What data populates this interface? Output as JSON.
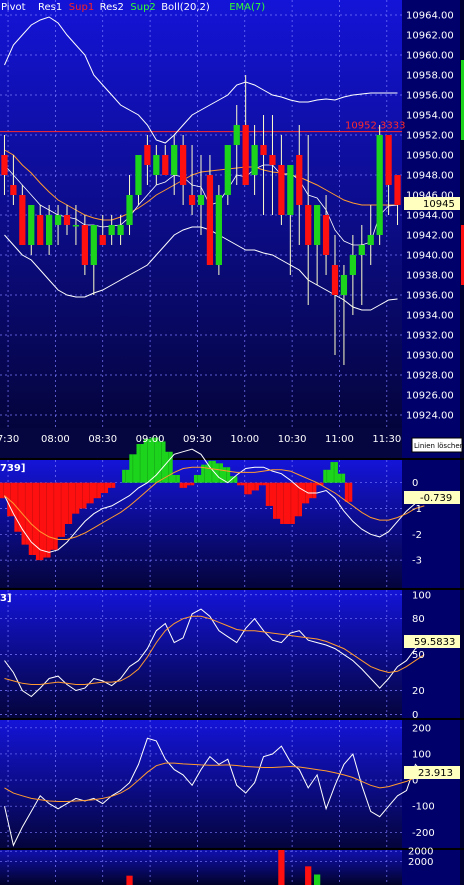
{
  "chart_data": [
    {
      "panel": "price",
      "type": "candlestick",
      "legend": [
        {
          "label": "Pivot",
          "color": "#ffffff"
        },
        {
          "label": "Res1",
          "color": "#ffffff"
        },
        {
          "label": "Sup1",
          "color": "#ff2020"
        },
        {
          "label": "Res2",
          "color": "#ffffff"
        },
        {
          "label": "Sup2",
          "color": "#30ff30"
        },
        {
          "label": "Boll(20,2)",
          "color": "#ffffff"
        },
        {
          "label": "EMA(7)",
          "color": "#30ff30"
        }
      ],
      "x_tick_labels": [
        "7:30",
        "08:00",
        "08:30",
        "09:00",
        "09:30",
        "10:00",
        "10:30",
        "11:00",
        "11:30"
      ],
      "y_tick_labels": [
        "10964.00",
        "10962.00",
        "10960.00",
        "10958.00",
        "10956.00",
        "10954.00",
        "10952.00",
        "10950.00",
        "10948.00",
        "10946.00",
        "10944.00",
        "10942.00",
        "10940.00",
        "10938.00",
        "10936.00",
        "10934.00",
        "10932.00",
        "10930.00",
        "10928.00",
        "10926.00",
        "10924.00"
      ],
      "ylim": [
        10922.7,
        10965.5
      ],
      "xlim": [
        0,
        45
      ],
      "ticks": [
        {
          "label": "10964.00",
          "value": 10964
        },
        {
          "label": "10962.00",
          "value": 10962
        },
        {
          "label": "10960.00",
          "value": 10960
        },
        {
          "label": "10958.00",
          "value": 10958
        },
        {
          "label": "10956.00",
          "value": 10956
        },
        {
          "label": "10954.00",
          "value": 10954
        },
        {
          "label": "10952.00",
          "value": 10952
        },
        {
          "label": "10950.00",
          "value": 10950
        },
        {
          "label": "10948.00",
          "value": 10948
        },
        {
          "label": "10946.00",
          "value": 10946
        },
        {
          "label": "10944.00",
          "value": 10944
        },
        {
          "label": "10942.00",
          "value": 10942
        },
        {
          "label": "10940.00",
          "value": 10940
        },
        {
          "label": "10938.00",
          "value": 10938
        },
        {
          "label": "10936.00",
          "value": 10936
        },
        {
          "label": "10934.00",
          "value": 10934
        },
        {
          "label": "10932.00",
          "value": 10932
        },
        {
          "label": "10930.00",
          "value": 10930
        },
        {
          "label": "10928.00",
          "value": 10928
        },
        {
          "label": "10926.00",
          "value": 10926
        },
        {
          "label": "10924.00",
          "value": 10924
        }
      ],
      "x_ticks": [
        {
          "label": "7:30",
          "index": 0.4
        },
        {
          "label": "08:00",
          "index": 5.7
        },
        {
          "label": "08:30",
          "index": 11.0
        },
        {
          "label": "09:00",
          "index": 16.3
        },
        {
          "label": "09:30",
          "index": 21.6
        },
        {
          "label": "10:00",
          "index": 26.9
        },
        {
          "label": "10:30",
          "index": 32.2
        },
        {
          "label": "11:00",
          "index": 37.5
        },
        {
          "label": "11:30",
          "index": 42.8
        }
      ],
      "candles": [
        {
          "o": 10950,
          "h": 10952,
          "l": 10946,
          "c": 10948
        },
        {
          "o": 10947,
          "h": 10950,
          "l": 10945,
          "c": 10946
        },
        {
          "o": 10946,
          "h": 10947,
          "l": 10941,
          "c": 10941
        },
        {
          "o": 10941,
          "h": 10945,
          "l": 10940,
          "c": 10945
        },
        {
          "o": 10944,
          "h": 10945,
          "l": 10941,
          "c": 10941
        },
        {
          "o": 10941,
          "h": 10945,
          "l": 10940,
          "c": 10944
        },
        {
          "o": 10943,
          "h": 10945,
          "l": 10941,
          "c": 10944
        },
        {
          "o": 10944,
          "h": 10945,
          "l": 10942,
          "c": 10943
        },
        {
          "o": 10943,
          "h": 10945,
          "l": 10941,
          "c": 10943
        },
        {
          "o": 10943,
          "h": 10944,
          "l": 10938,
          "c": 10939
        },
        {
          "o": 10939,
          "h": 10943,
          "l": 10936,
          "c": 10943
        },
        {
          "o": 10942,
          "h": 10944,
          "l": 10941,
          "c": 10941
        },
        {
          "o": 10942,
          "h": 10944,
          "l": 10941,
          "c": 10943
        },
        {
          "o": 10942,
          "h": 10944,
          "l": 10941,
          "c": 10943
        },
        {
          "o": 10943,
          "h": 10948,
          "l": 10942,
          "c": 10946
        },
        {
          "o": 10946,
          "h": 10950,
          "l": 10945,
          "c": 10950
        },
        {
          "o": 10951,
          "h": 10952,
          "l": 10947,
          "c": 10949
        },
        {
          "o": 10948,
          "h": 10951,
          "l": 10947,
          "c": 10950
        },
        {
          "o": 10950,
          "h": 10951,
          "l": 10948,
          "c": 10948
        },
        {
          "o": 10948,
          "h": 10952,
          "l": 10946,
          "c": 10951
        },
        {
          "o": 10951,
          "h": 10952,
          "l": 10945,
          "c": 10947
        },
        {
          "o": 10946,
          "h": 10951,
          "l": 10944,
          "c": 10945
        },
        {
          "o": 10945,
          "h": 10950,
          "l": 10942,
          "c": 10946
        },
        {
          "o": 10948,
          "h": 10950,
          "l": 10939,
          "c": 10939
        },
        {
          "o": 10939,
          "h": 10947,
          "l": 10938,
          "c": 10946
        },
        {
          "o": 10946,
          "h": 10951,
          "l": 10945,
          "c": 10951
        },
        {
          "o": 10951,
          "h": 10955,
          "l": 10947,
          "c": 10953
        },
        {
          "o": 10953,
          "h": 10958,
          "l": 10948,
          "c": 10947
        },
        {
          "o": 10948,
          "h": 10953,
          "l": 10946,
          "c": 10951
        },
        {
          "o": 10951,
          "h": 10954,
          "l": 10944,
          "c": 10950
        },
        {
          "o": 10950,
          "h": 10954,
          "l": 10944,
          "c": 10949
        },
        {
          "o": 10949,
          "h": 10952,
          "l": 10943,
          "c": 10944
        },
        {
          "o": 10944,
          "h": 10949,
          "l": 10938,
          "c": 10949
        },
        {
          "o": 10950,
          "h": 10953,
          "l": 10941,
          "c": 10945
        },
        {
          "o": 10945,
          "h": 10952,
          "l": 10935,
          "c": 10941
        },
        {
          "o": 10941,
          "h": 10945,
          "l": 10937,
          "c": 10945
        },
        {
          "o": 10944,
          "h": 10946,
          "l": 10938,
          "c": 10940
        },
        {
          "o": 10939,
          "h": 10942,
          "l": 10930,
          "c": 10936
        },
        {
          "o": 10936,
          "h": 10939,
          "l": 10929,
          "c": 10938
        },
        {
          "o": 10938,
          "h": 10942,
          "l": 10934,
          "c": 10940
        },
        {
          "o": 10940,
          "h": 10943,
          "l": 10935,
          "c": 10941
        },
        {
          "o": 10941,
          "h": 10945,
          "l": 10939,
          "c": 10942
        },
        {
          "o": 10942,
          "h": 10953,
          "l": 10941,
          "c": 10952
        },
        {
          "o": 10952,
          "h": 10952,
          "l": 10944,
          "c": 10947
        },
        {
          "o": 10948,
          "h": 10948,
          "l": 10943,
          "c": 10945
        }
      ],
      "boll_upper": [
        10959,
        10961,
        10962,
        10963,
        10963.5,
        10963.8,
        10963.2,
        10962,
        10961,
        10960,
        10958,
        10957,
        10956,
        10955,
        10954.5,
        10954,
        10953,
        10951.5,
        10951.2,
        10952,
        10953,
        10954,
        10954.5,
        10955,
        10955.5,
        10956,
        10957,
        10957.3,
        10957,
        10956.5,
        10956,
        10955.8,
        10955.5,
        10955.3,
        10955.3,
        10955.5,
        10955.6,
        10955.5,
        10955.8,
        10956,
        10956.1,
        10956.2,
        10956.2,
        10956.2,
        10956.2
      ],
      "boll_lower": [
        10942,
        10941,
        10940,
        10939.5,
        10938.5,
        10937.5,
        10936.5,
        10936,
        10935.8,
        10935.8,
        10936.2,
        10936.5,
        10937,
        10937.5,
        10938,
        10938.5,
        10939,
        10940,
        10941,
        10942,
        10942.5,
        10942.8,
        10942.8,
        10942.5,
        10942,
        10941.5,
        10941,
        10940.5,
        10940.5,
        10940.2,
        10940,
        10939.5,
        10939,
        10938.5,
        10937.5,
        10937,
        10936.5,
        10936,
        10935.5,
        10934.8,
        10934.5,
        10934.5,
        10935,
        10935.5,
        10935.6
      ],
      "boll_mid": [
        10950.5,
        10950,
        10949,
        10948.2,
        10947.2,
        10946.3,
        10945.5,
        10945,
        10944.5,
        10944,
        10943.7,
        10943.5,
        10943.5,
        10943.8,
        10944.2,
        10944.7,
        10945.3,
        10946,
        10946.5,
        10947,
        10947.5,
        10948,
        10948.3,
        10948.4,
        10948.5,
        10948.6,
        10948.7,
        10948.8,
        10948.8,
        10948.5,
        10948.3,
        10948.2,
        10948,
        10947.8,
        10947.4,
        10947,
        10946.5,
        10946,
        10945.5,
        10945.2,
        10945,
        10945,
        10945,
        10945,
        10945
      ],
      "ema": [
        10949,
        10948,
        10947,
        10946,
        10945,
        10944.5,
        10944,
        10943.8,
        10943.6,
        10943,
        10943,
        10942.8,
        10942.9,
        10943,
        10943.8,
        10945,
        10946,
        10947,
        10947.3,
        10948,
        10947.8,
        10947,
        10946.8,
        10945,
        10945.3,
        10946.6,
        10948,
        10947.8,
        10948.6,
        10949,
        10949,
        10948,
        10948.2,
        10947.5,
        10946,
        10945.7,
        10944.5,
        10942.5,
        10941.4,
        10941,
        10941,
        10941.3,
        10944,
        10944.9,
        10945
      ]
    },
    {
      "panel": "osc1",
      "type": "histogram+lines",
      "header_label": "739]",
      "ylim": [
        -4.08,
        0.88
      ],
      "ticks": [
        {
          "label": "0",
          "value": 0
        },
        {
          "label": "-1",
          "value": -1
        },
        {
          "label": "-2",
          "value": -2
        },
        {
          "label": "-3",
          "value": -3
        }
      ],
      "value_label": "-0.739",
      "histogram": [
        -0.6,
        -1.3,
        -1.9,
        -2.4,
        -2.8,
        -3.0,
        -2.9,
        -2.6,
        -2.1,
        -1.6,
        -1.2,
        -1.0,
        -0.8,
        -0.6,
        -0.4,
        -0.2,
        0.0,
        0.5,
        1.1,
        1.5,
        1.7,
        1.75,
        1.6,
        1.2,
        0.3,
        -0.2,
        -0.1,
        0.3,
        0.7,
        0.85,
        0.75,
        0.6,
        0.25,
        -0.1,
        -0.45,
        -0.3,
        -0.1,
        -0.9,
        -1.4,
        -1.6,
        -1.6,
        -1.3,
        -0.8,
        -0.6,
        -0.1,
        0.5,
        0.8,
        0.35,
        -0.739
      ],
      "line1": [
        -0.5,
        -1.2,
        -1.8,
        -2.3,
        -2.6,
        -2.7,
        -2.6,
        -2.3,
        -1.9,
        -1.5,
        -1.2,
        -1.0,
        -0.9,
        -0.7,
        -0.5,
        -0.2,
        0.0,
        0.3,
        0.7,
        1.1,
        1.2,
        1.3,
        1.1,
        0.6,
        0.2,
        0.0,
        0.3,
        0.55,
        0.6,
        0.6,
        0.45,
        0.35,
        0.1,
        -0.2,
        -0.4,
        -0.4,
        -0.3,
        -0.6,
        -1.1,
        -1.5,
        -1.8,
        -2.0,
        -2.1,
        -1.9,
        -1.5,
        -1.1,
        -0.8,
        -0.74
      ],
      "line2": [
        -0.5,
        -0.8,
        -1.2,
        -1.6,
        -1.9,
        -2.1,
        -2.2,
        -2.2,
        -2.1,
        -1.95,
        -1.75,
        -1.55,
        -1.35,
        -1.15,
        -0.9,
        -0.6,
        -0.3,
        0.0,
        0.2,
        0.4,
        0.55,
        0.6,
        0.6,
        0.55,
        0.5,
        0.45,
        0.4,
        0.4,
        0.4,
        0.45,
        0.5,
        0.5,
        0.45,
        0.3,
        0.15,
        0.0,
        -0.2,
        -0.4,
        -0.65,
        -0.9,
        -1.15,
        -1.35,
        -1.45,
        -1.45,
        -1.35,
        -1.2,
        -1.0,
        -0.9
      ]
    },
    {
      "panel": "osc2",
      "type": "lines",
      "header_label": "3]",
      "ylim": [
        -3,
        104
      ],
      "ticks": [
        {
          "label": "100",
          "value": 100
        },
        {
          "label": "80",
          "value": 80
        },
        {
          "label": "50",
          "value": 50
        },
        {
          "label": "20",
          "value": 20
        },
        {
          "label": "0",
          "value": 0
        }
      ],
      "value_label": "59.5833",
      "line_white": [
        45,
        35,
        20,
        15,
        22,
        30,
        32,
        25,
        20,
        22,
        30,
        28,
        24,
        30,
        40,
        45,
        55,
        70,
        76,
        60,
        64,
        84,
        88,
        82,
        70,
        65,
        60,
        72,
        80,
        70,
        62,
        60,
        68,
        70,
        62,
        60,
        58,
        55,
        50,
        45,
        38,
        30,
        22,
        30,
        40,
        45,
        55,
        59.6
      ],
      "line_orange": [
        30,
        28,
        26,
        25,
        25,
        26,
        27,
        26,
        25,
        25,
        26,
        27,
        27,
        28,
        32,
        38,
        48,
        60,
        70,
        76,
        80,
        82,
        82,
        80,
        77,
        74,
        71,
        70,
        70,
        69,
        68,
        67,
        66,
        65,
        64,
        63,
        61,
        58,
        55,
        50,
        45,
        40,
        37,
        35,
        36,
        40,
        45,
        50
      ]
    },
    {
      "panel": "osc3",
      "type": "lines",
      "ylim": [
        -260,
        230
      ],
      "ticks": [
        {
          "label": "200",
          "value": 200
        },
        {
          "label": "100",
          "value": 100
        },
        {
          "label": "0",
          "value": 0
        },
        {
          "label": "-100",
          "value": -100
        },
        {
          "label": "-200",
          "value": -200
        }
      ],
      "value_label": "23.913",
      "line_white": [
        -100,
        -250,
        -180,
        -120,
        -60,
        -90,
        -110,
        -90,
        -70,
        -80,
        -70,
        -90,
        -60,
        -40,
        -10,
        60,
        160,
        150,
        80,
        40,
        20,
        -20,
        40,
        90,
        60,
        80,
        -20,
        -50,
        -10,
        90,
        100,
        130,
        70,
        40,
        -30,
        20,
        -110,
        -20,
        60,
        100,
        -20,
        -120,
        -140,
        -100,
        -60,
        -40,
        60,
        23.9
      ],
      "line_orange": [
        -30,
        -50,
        -60,
        -70,
        -75,
        -80,
        -82,
        -82,
        -80,
        -78,
        -75,
        -70,
        -62,
        -50,
        -30,
        0,
        30,
        55,
        65,
        65,
        62,
        60,
        58,
        57,
        57,
        58,
        56,
        52,
        50,
        48,
        48,
        50,
        52,
        50,
        45,
        40,
        35,
        28,
        20,
        10,
        -5,
        -20,
        -30,
        -25,
        -15,
        -5,
        10,
        20
      ]
    },
    {
      "panel": "volume",
      "type": "bar",
      "ylim": [
        0,
        3000
      ],
      "ticks": [
        {
          "label": "2000",
          "value": 2000
        },
        {
          "label": "2000",
          "value": 2900
        }
      ],
      "bars": [
        {
          "index": 14,
          "value": 800,
          "color": "#ff1010"
        },
        {
          "index": 31,
          "value": 3500,
          "color": "#ff1010"
        },
        {
          "index": 34,
          "value": 1600,
          "color": "#ff1010"
        },
        {
          "index": 35,
          "value": 900,
          "color": "#1cd41c"
        }
      ]
    }
  ],
  "pivot_line": {
    "label": "10952.3333",
    "value": 10952.3333,
    "color": "#ff2a2a"
  },
  "last_price_label": "10945",
  "side_panel_label": "Linien löschen",
  "colors": {
    "background_top": "#1010c8",
    "background_bottom": "#050548",
    "bull": "#1cd41c",
    "bear": "#ff1010",
    "grid": "#6f6fe8"
  }
}
